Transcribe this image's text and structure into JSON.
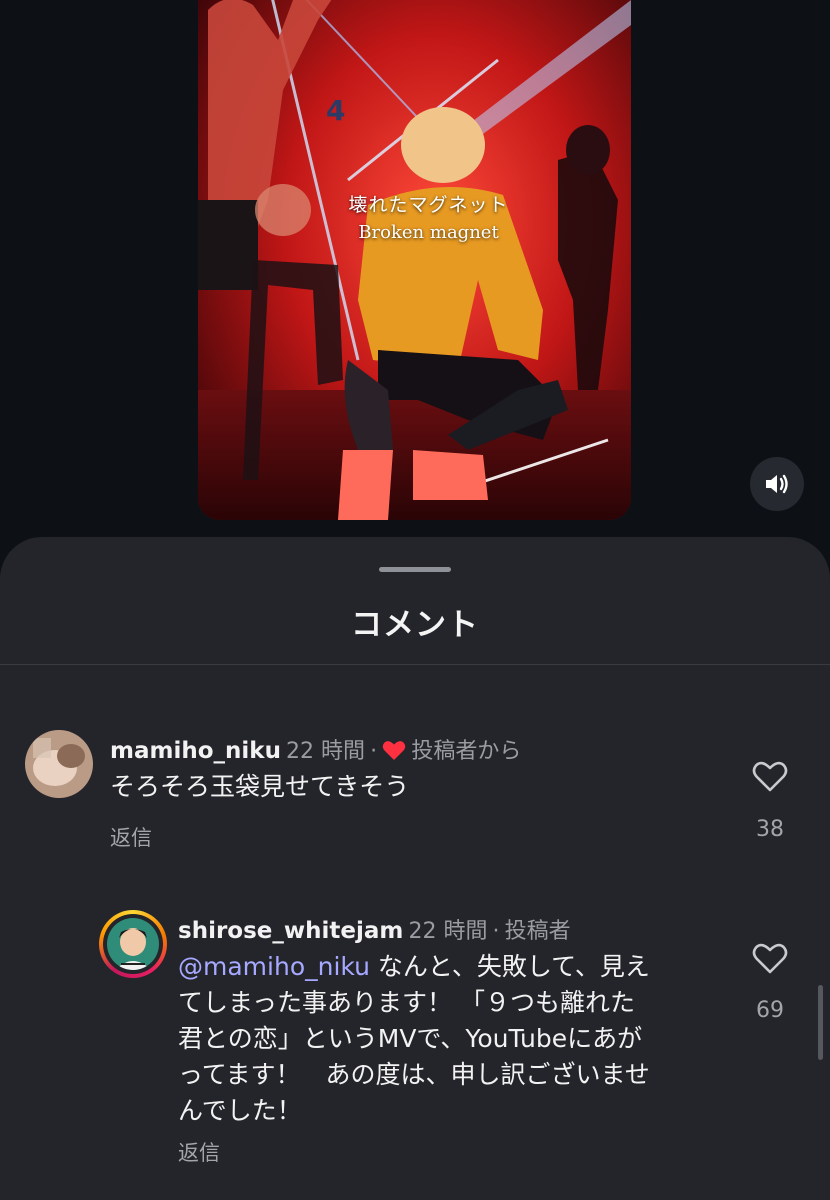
{
  "video": {
    "caption_jp": "壊れたマグネット",
    "caption_en": "Broken magnet",
    "sound_icon": "speaker-icon"
  },
  "comments_sheet": {
    "title": "コメント",
    "comments": [
      {
        "username": "mamiho_niku",
        "time": "22 時間",
        "separator": "·",
        "creator_liked_label": "投稿者から",
        "text": "そろそろ玉袋見せてきそう",
        "reply_label": "返信",
        "likes": "38"
      },
      {
        "username": "shirose_whitejam",
        "time": "22 時間",
        "separator": "·",
        "author_label": "投稿者",
        "mention": "@mamiho_niku",
        "text_lines": [
          " なんと、失敗して、見え",
          "てしまった事あります！ 「９つも離れた",
          "君との恋」というMVで、YouTubeにあが",
          "ってます！　あの度は、申し訳ございませ",
          "んでした！"
        ],
        "reply_label": "返信",
        "likes": "69"
      }
    ]
  },
  "colors": {
    "sheet_bg": "#23252b",
    "page_bg": "#0d1116",
    "mention": "#a7a8ff",
    "heart_red": "#ff3040"
  }
}
